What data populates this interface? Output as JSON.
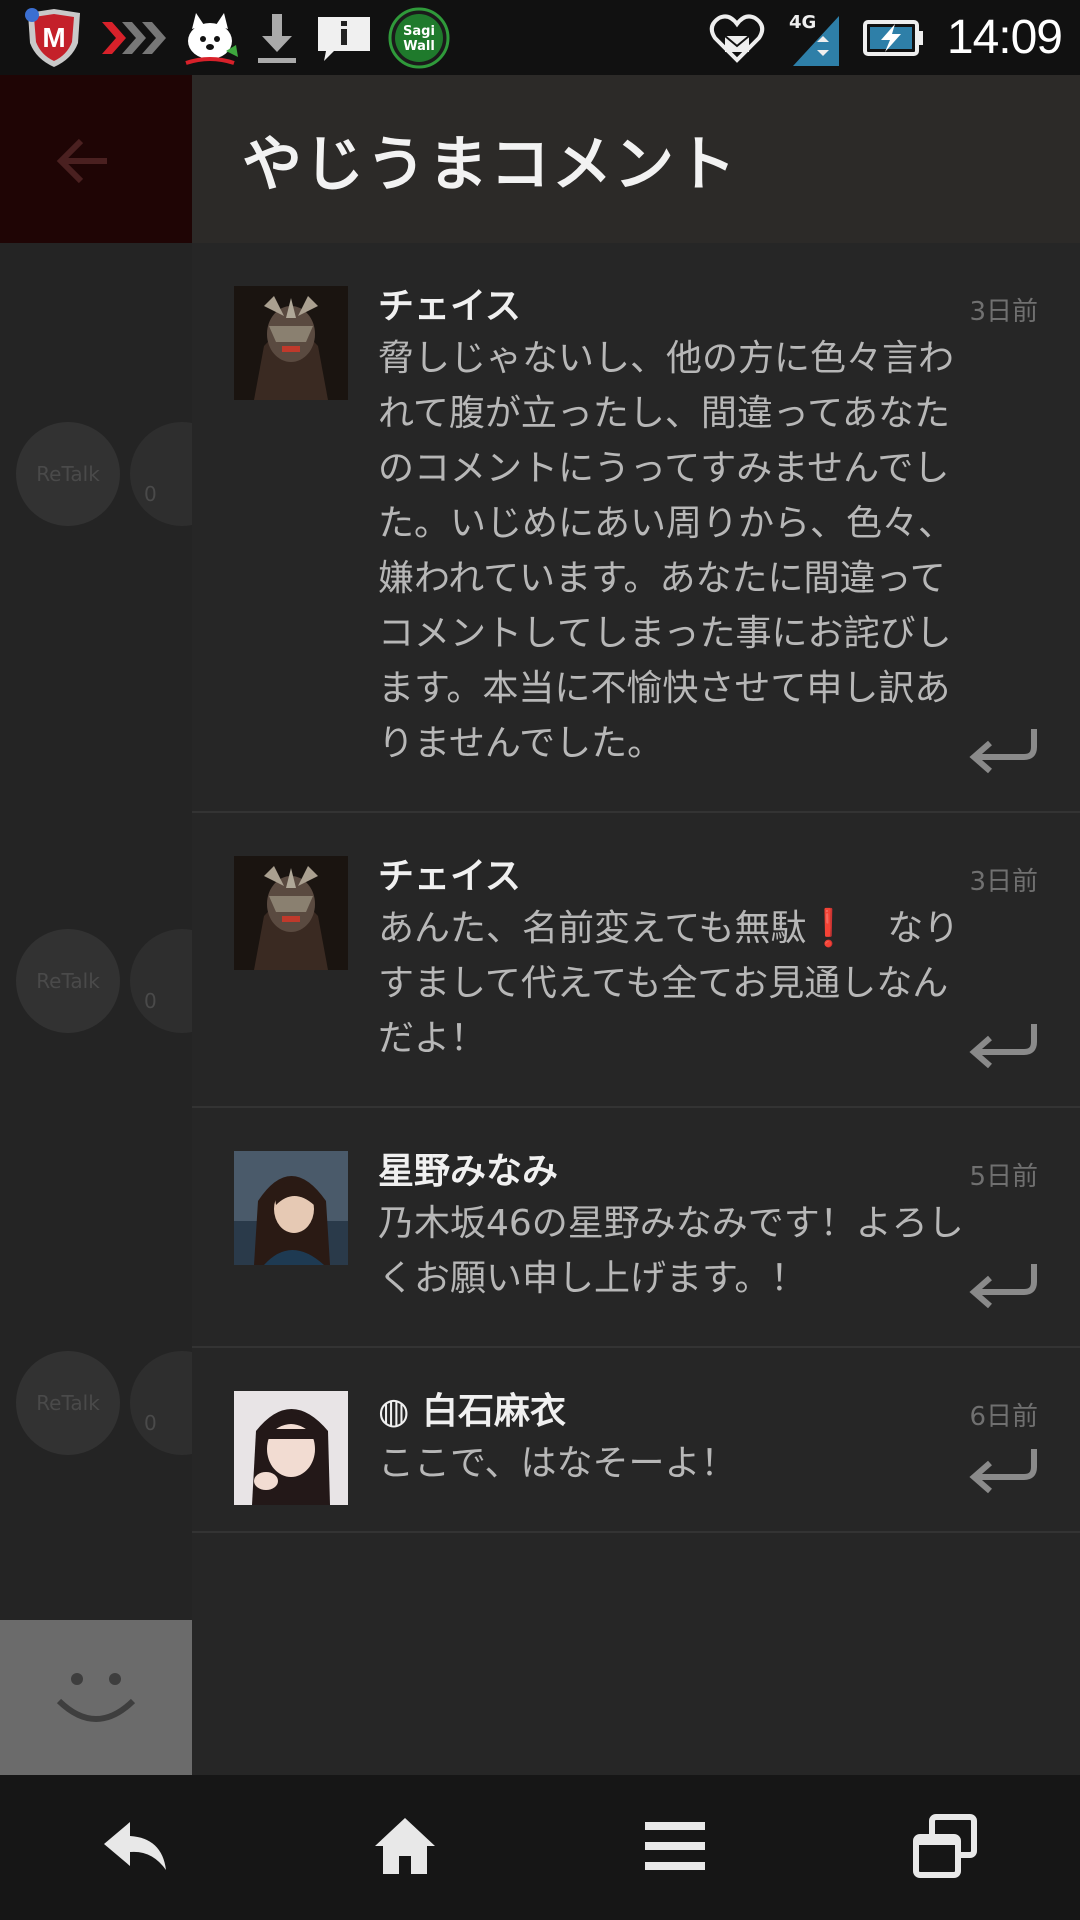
{
  "status_bar": {
    "time": "14:09",
    "network": "4G",
    "sagi_line1": "Sagi",
    "sagi_line2": "Wall"
  },
  "background": {
    "retalk_label": "ReTalk",
    "count_label": "0"
  },
  "drawer": {
    "title": "やじうまコメント",
    "comments": [
      {
        "name": "チェイス",
        "time": "3日前",
        "text": "脅しじゃないし、他の方に色々言われて腹が立ったし、間違ってあなたのコメントにうってすみませんでした。いじめにあい周りから、色々、嫌われています。あなたに間違ってコメントしてしまった事にお詫びします。本当に不愉快させて申し訳ありませんでした。"
      },
      {
        "name": "チェイス",
        "time": "3日前",
        "text": "あんた、名前変えても無駄❗　なりすまして代えても全てお見通しなんだよ！"
      },
      {
        "name": "星野みなみ",
        "time": "5日前",
        "text": "乃木坂46の星野みなみです！よろしくお願い申し上げます。！"
      },
      {
        "name": "◍ 白石麻衣",
        "time": "6日前",
        "text": "ここで、はなそーよ！"
      }
    ]
  },
  "colors": {
    "panel_bg": "#262626",
    "header_bg": "#2c2a28",
    "text_primary": "#f0f0f0",
    "text_secondary": "#b7b7b7"
  }
}
